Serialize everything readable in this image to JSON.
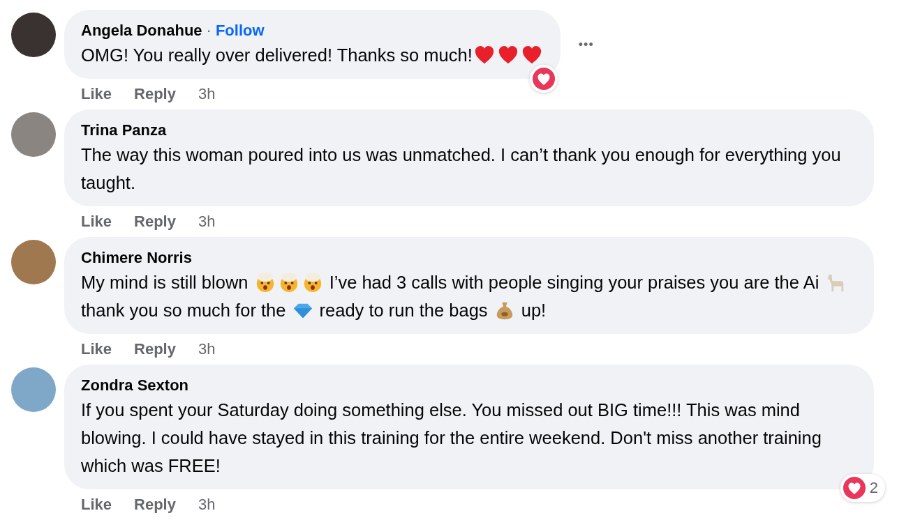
{
  "comments": [
    {
      "author": "Angela Donahue",
      "separator": "·",
      "follow": "Follow",
      "segments": [
        {
          "kind": "text",
          "text": "OMG! You really over delivered! Thanks so much!"
        },
        {
          "kind": "heart"
        },
        {
          "kind": "heart"
        },
        {
          "kind": "heart"
        }
      ],
      "actions": [
        "Like",
        "Reply"
      ],
      "time": "3h",
      "more": "•••",
      "reaction": {
        "kind": "heart"
      }
    },
    {
      "author": "Trina Panza",
      "segments": [
        {
          "kind": "text",
          "text": "The way this woman poured into us was unmatched. I can’t thank you enough for everything you taught."
        }
      ],
      "actions": [
        "Like",
        "Reply"
      ],
      "time": "3h"
    },
    {
      "author": "Chimere Norris",
      "segments": [
        {
          "kind": "text",
          "text": "My mind is still blown "
        },
        {
          "kind": "mindblown"
        },
        {
          "kind": "mindblown"
        },
        {
          "kind": "mindblown"
        },
        {
          "kind": "text",
          "text": " I’ve had 3 calls with people singing your praises you are the Ai "
        },
        {
          "kind": "llama"
        },
        {
          "kind": "text",
          "text": " thank you so much for the "
        },
        {
          "kind": "diamond"
        },
        {
          "kind": "text",
          "text": " ready to run the bags "
        },
        {
          "kind": "moneybag"
        },
        {
          "kind": "text",
          "text": " up!"
        }
      ],
      "actions": [
        "Like",
        "Reply"
      ],
      "time": "3h"
    },
    {
      "author": "Zondra Sexton",
      "segments": [
        {
          "kind": "text",
          "text": "If you spent your Saturday doing something else. You missed out BIG time!!! This was mind blowing. I could have stayed in this training for the entire weekend. Don't miss another training which was FREE!"
        }
      ],
      "actions": [
        "Like",
        "Reply"
      ],
      "time": "3h",
      "reaction": {
        "kind": "heart",
        "count": "2"
      }
    }
  ]
}
